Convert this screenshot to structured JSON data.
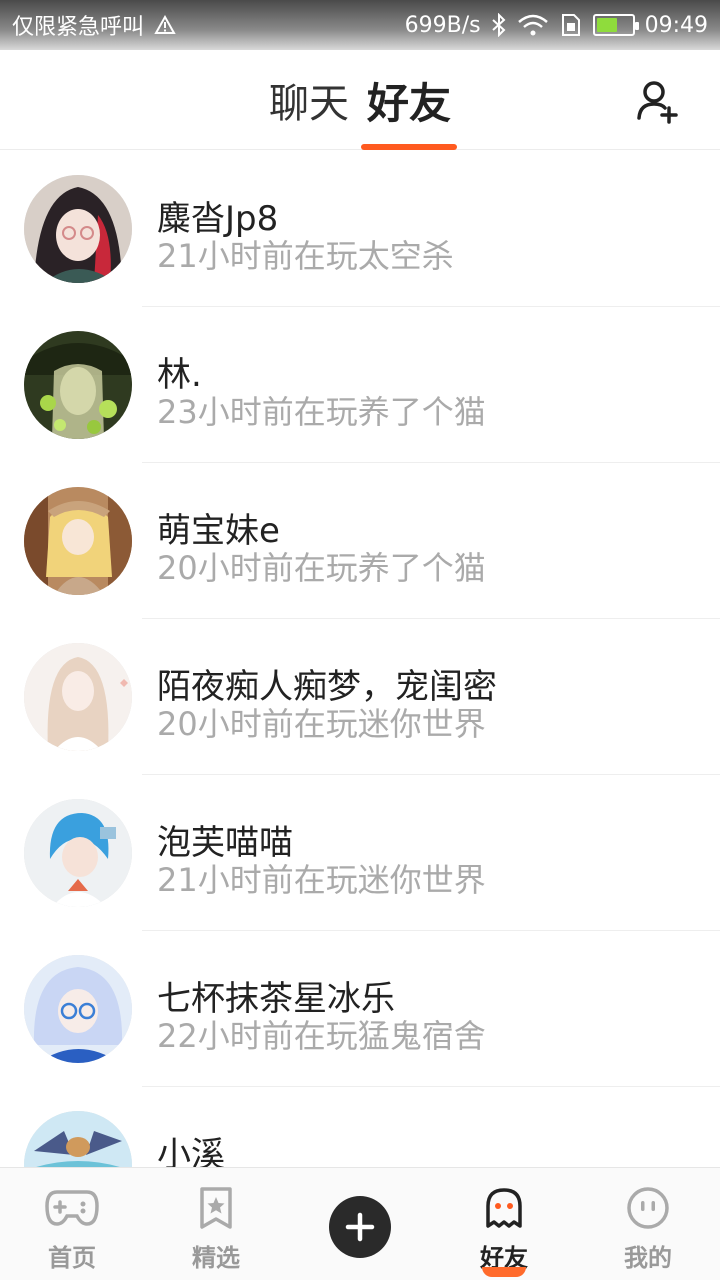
{
  "status_bar": {
    "left_text": "仅限紧急呼叫",
    "net_speed": "699B/s",
    "time": "09:49",
    "battery_level": 0.6
  },
  "header": {
    "tabs": [
      {
        "label": "聊天"
      },
      {
        "label": "好友"
      }
    ],
    "active_tab": "好友",
    "accent_color": "#ff5a1f"
  },
  "friends": [
    {
      "name": "麋沓Jp8",
      "status": "21小时前在玩太空杀"
    },
    {
      "name": "林.",
      "status": "23小时前在玩养了个猫"
    },
    {
      "name": "萌宝妹e",
      "status": "20小时前在玩养了个猫"
    },
    {
      "name": "陌夜痴人痴梦，宠闺密",
      "status": "20小时前在玩迷你世界"
    },
    {
      "name": "泡芙喵喵",
      "status": "21小时前在玩迷你世界"
    },
    {
      "name": "七杯抹茶星冰乐",
      "status": "22小时前在玩猛鬼宿舍"
    },
    {
      "name": "小溪",
      "status": ""
    }
  ],
  "bottom_nav": {
    "items": [
      {
        "label": "首页",
        "icon": "gamepad-icon"
      },
      {
        "label": "精选",
        "icon": "star-bookmark-icon"
      },
      {
        "label": "",
        "icon": "plus-icon"
      },
      {
        "label": "好友",
        "icon": "ghost-icon"
      },
      {
        "label": "我的",
        "icon": "face-icon"
      }
    ],
    "active": "好友"
  }
}
